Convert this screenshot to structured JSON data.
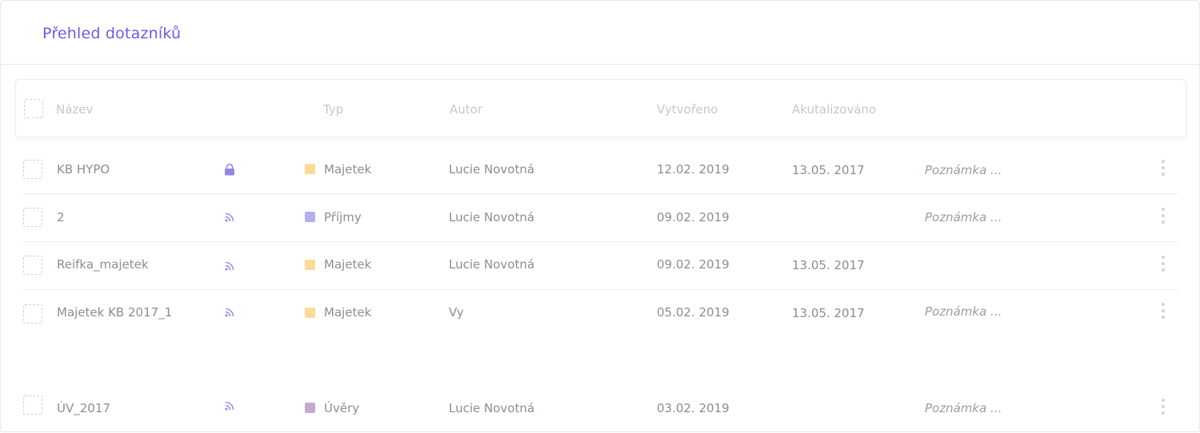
{
  "title": "Přehled dotazníků",
  "columns": {
    "name": "Název",
    "type": "Typ",
    "author": "Autor",
    "created": "Vytvořeno",
    "updated": "Akutalizováno"
  },
  "colors": {
    "accent": "#6c5ce7",
    "majetek": "#fddb96",
    "prijmy": "#b3b0ef",
    "uvery": "#c7a8cf"
  },
  "rows": [
    {
      "name": "KB  HYPO",
      "icon": "lock-icon",
      "type": "Majetek",
      "type_color": "#fddb96",
      "author": "Lucie Novotná",
      "created": "12.02. 2019",
      "updated": "13.05. 2017",
      "note": "Poznámka ..."
    },
    {
      "name": "2",
      "icon": "rss-icon",
      "type": "Příjmy",
      "type_color": "#b3b0ef",
      "author": "Lucie Novotná",
      "created": "09.02. 2019",
      "updated": "",
      "note": "Poznámka ..."
    },
    {
      "name": "Reifka_majetek",
      "icon": "rss-icon",
      "type": "Majetek",
      "type_color": "#fddb96",
      "author": "Lucie Novotná",
      "created": "09.02. 2019",
      "updated": "13.05. 2017",
      "note": ""
    },
    {
      "name": "Majetek KB 2017_1",
      "icon": "rss-icon",
      "type": "Majetek",
      "type_color": "#fddb96",
      "author": "Vy",
      "created": "05.02. 2019",
      "updated": "13.05. 2017",
      "note": "Poznámka ..."
    },
    {
      "name": "ÚV_2017",
      "icon": "rss-icon",
      "type": "Úvěry",
      "type_color": "#c7a8cf",
      "author": "Lucie Novotná",
      "created": "03.02. 2019",
      "updated": "",
      "note": "Poznámka ..."
    }
  ]
}
